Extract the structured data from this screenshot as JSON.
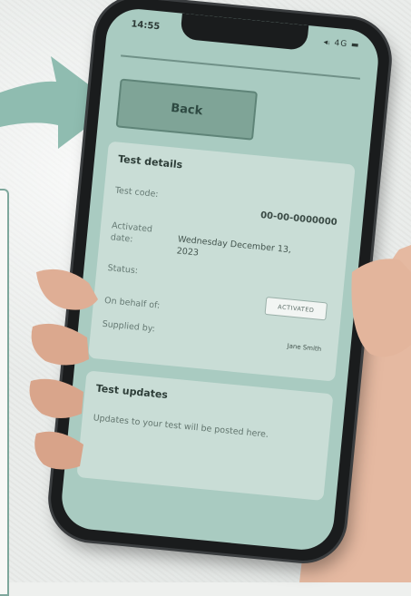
{
  "phone": {
    "time": "14:55",
    "status_icons": "◂ᵢ 4G ▬",
    "back_label": "Back",
    "details": {
      "title": "Test details",
      "test_code_label": "Test code:",
      "test_code_value": "00-00-0000000",
      "activated_date_label": "Activated date:",
      "activated_date_value": "Wednesday December 13, 2023",
      "status_label": "Status:",
      "status_value": "ACTIVATED",
      "on_behalf_label": "On behalf of:",
      "supplied_by_label": "Supplied by:",
      "supplied_by_value": "Jane Smith"
    },
    "updates": {
      "title": "Test updates",
      "text": "Updates to your test will be posted here."
    }
  },
  "colors": {
    "screen": "#a9cbc1",
    "arrow": "#8fbcb0",
    "button": "#7fa497",
    "card": "#c9ddd6",
    "side_card_border": "#7ea79c"
  },
  "icons": [
    "arrow-icon",
    "signal-icon",
    "battery-icon"
  ]
}
